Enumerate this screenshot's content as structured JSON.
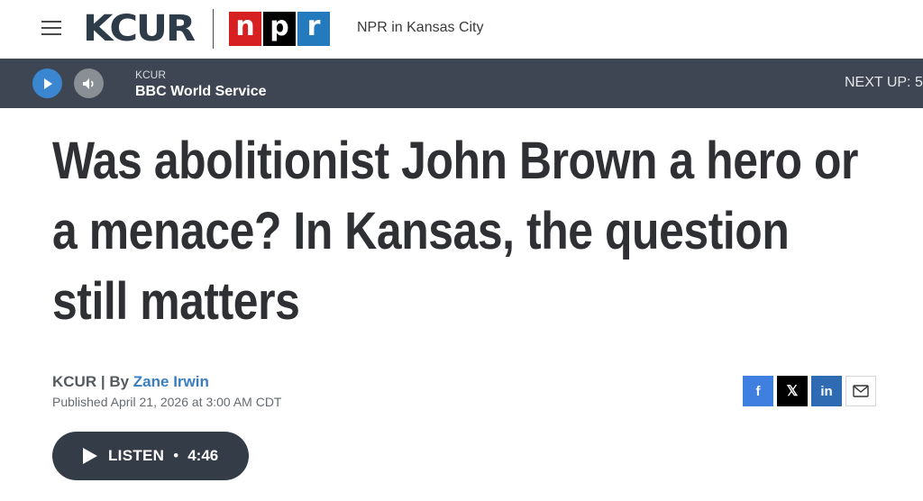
{
  "header": {
    "logo_text": "KCUR",
    "npr_letters": [
      "n",
      "p",
      "r"
    ],
    "tagline": "NPR in Kansas City"
  },
  "player": {
    "station": "KCUR",
    "program": "BBC World Service",
    "next_up": "NEXT UP: 5:"
  },
  "article": {
    "headline": "Was abolitionist John Brown a hero or a menace? In Kansas, the question still matters",
    "source": "KCUR",
    "separator": "| By",
    "author": "Zane Irwin",
    "published": "Published April 21, 2026 at 3:00 AM CDT"
  },
  "share": {
    "facebook": "f",
    "twitter": "𝕏",
    "linkedin": "in",
    "icons": [
      "facebook-icon",
      "x-icon",
      "linkedin-icon",
      "email-icon"
    ]
  },
  "listen": {
    "label": "LISTEN",
    "dot": "•",
    "duration": "4:46"
  },
  "colors": {
    "player_bar": "#3d4652",
    "play_button": "#3a86d0",
    "npr_red": "#d62021",
    "npr_black": "#000000",
    "npr_blue": "#237bbd",
    "author_link": "#3a7ec1",
    "facebook": "#3f7fe0",
    "linkedin": "#2e6bb3"
  }
}
